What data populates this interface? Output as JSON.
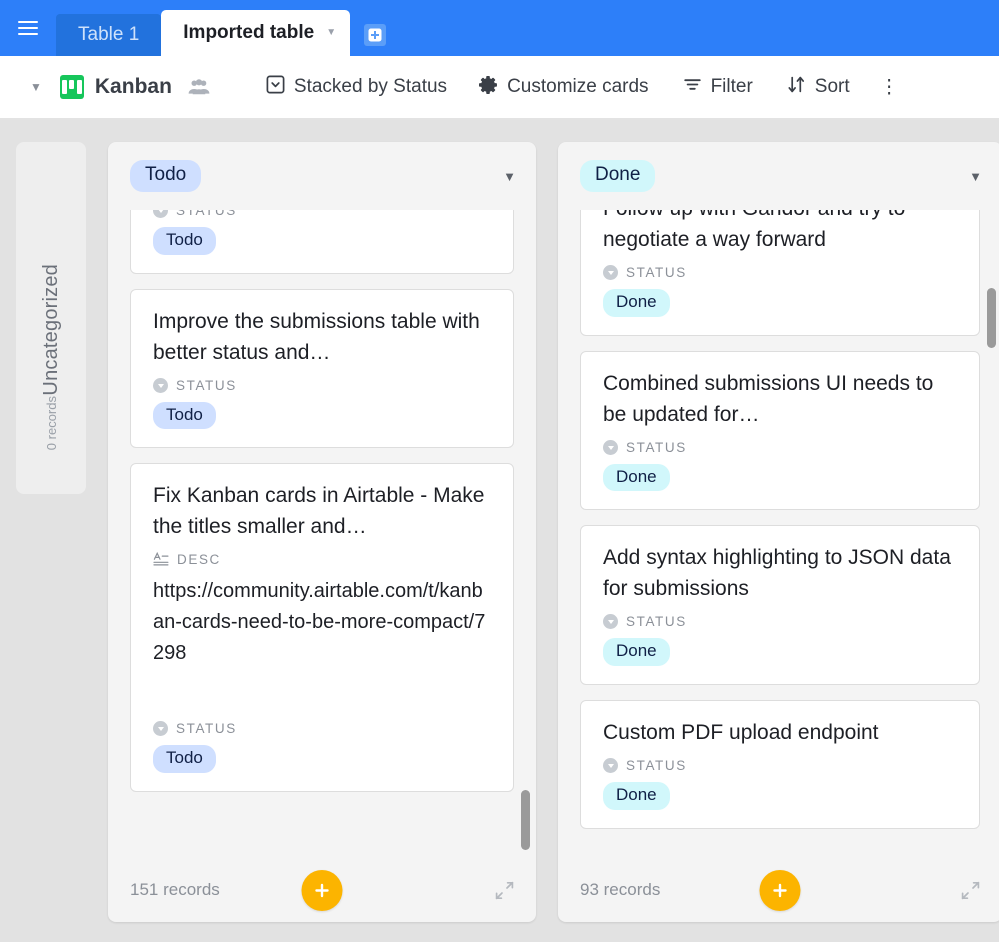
{
  "topbar": {
    "menu_icon": "hamburger-icon",
    "tabs": [
      {
        "label": "Table 1",
        "active": false
      },
      {
        "label": "Imported table",
        "active": true
      }
    ],
    "active_tab_caret": "▼",
    "add_tab_icon": "add-table-icon"
  },
  "toolbar": {
    "collapse_caret": "▼",
    "view_icon": "kanban-icon",
    "view_name": "Kanban",
    "collaborators_icon": "people-icon",
    "stacked_label": "Stacked by Status",
    "stacked_icon": "single-select-icon",
    "customize_label": "Customize cards",
    "customize_icon": "gear-icon",
    "filter_label": "Filter",
    "filter_icon": "filter-icon",
    "sort_label": "Sort",
    "sort_icon": "sort-icon",
    "overflow_label": "⋮"
  },
  "colors": {
    "brand_blue": "#2d7ff9",
    "kanban_green": "#16c65b",
    "add_record_orange": "#fcb400",
    "todo_pill_bg": "#cfdfff",
    "done_pill_bg": "#d1f7fb",
    "pill_text": "#102046",
    "board_bg": "#e2e2e2",
    "stack_bg": "#f4f4f4"
  },
  "board": {
    "collapsed_stack": {
      "title": "Uncategorized",
      "records": "0 records"
    },
    "stacks": [
      {
        "name": "todo",
        "pill_label": "Todo",
        "pill_bg": "#cfdfff",
        "menu_caret": "▼",
        "records": "151 records",
        "add_record_icon": "plus-icon",
        "collapse_icon": "collapse-icon",
        "cards": [
          {
            "clipped": true,
            "title": "",
            "status_label": "STATUS",
            "status_value": "Todo"
          },
          {
            "clipped": false,
            "title": "Improve the submissions table with better status and…",
            "status_label": "STATUS",
            "status_value": "Todo"
          },
          {
            "clipped": false,
            "title": "Fix Kanban cards in Airtable - Make the titles smaller and…",
            "desc_label": "DESC",
            "desc_value": "https://community.airtable.com/t/kanban-cards-need-to-be-more-compact/7298",
            "status_label": "STATUS",
            "status_value": "Todo"
          }
        ]
      },
      {
        "name": "done",
        "pill_label": "Done",
        "pill_bg": "#d1f7fb",
        "menu_caret": "▼",
        "records": "93 records",
        "add_record_icon": "plus-icon",
        "collapse_icon": "collapse-icon",
        "cards": [
          {
            "clipped": true,
            "title": "Follow up with Gandor and try to negotiate a way forward",
            "status_label": "STATUS",
            "status_value": "Done"
          },
          {
            "clipped": false,
            "title": "Combined submissions UI needs to be updated for…",
            "status_label": "STATUS",
            "status_value": "Done"
          },
          {
            "clipped": false,
            "title": "Add syntax highlighting to JSON data for submissions",
            "status_label": "STATUS",
            "status_value": "Done"
          },
          {
            "clipped": false,
            "title": "Custom PDF upload endpoint",
            "status_label": "STATUS",
            "status_value": "Done"
          }
        ]
      }
    ]
  }
}
